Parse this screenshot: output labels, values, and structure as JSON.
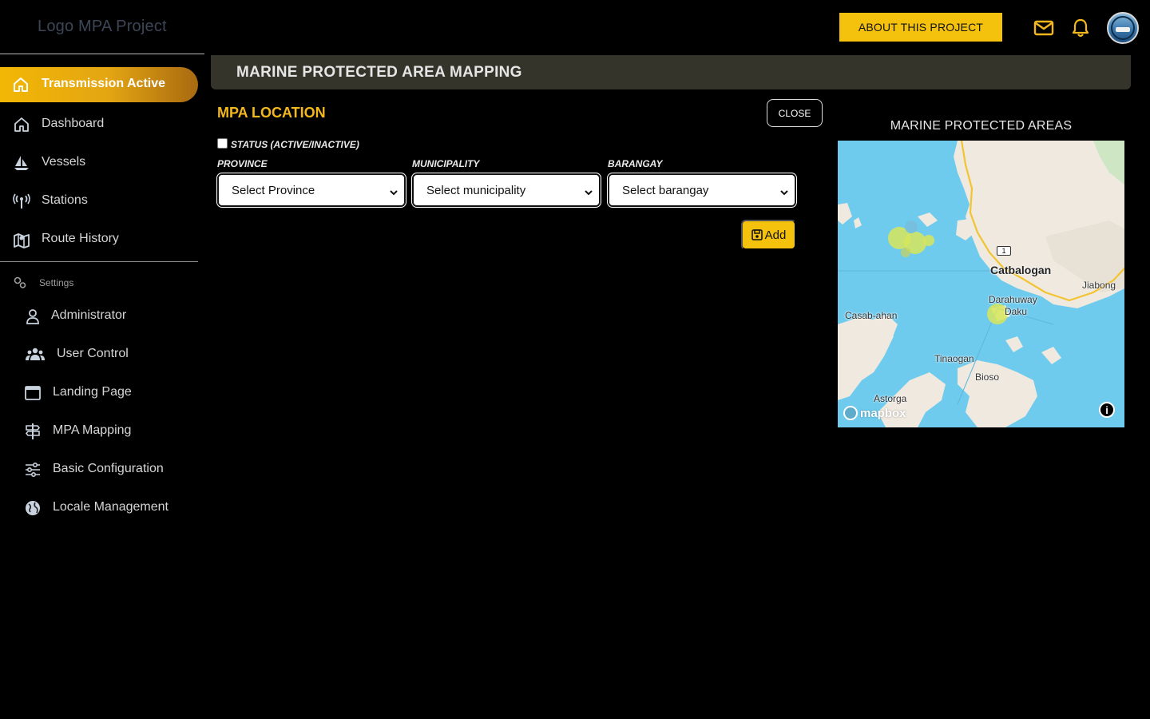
{
  "app": {
    "logo_text": "Logo MPA Project",
    "about_button": "ABOUT THIS PROJECT",
    "mail_icon": "mail-icon",
    "bell_icon": "bell-icon"
  },
  "sidebar": {
    "active_item": {
      "label": "Transmission Active",
      "icon": "home-icon"
    },
    "items": [
      {
        "label": "Dashboard",
        "icon": "home-icon"
      },
      {
        "label": "Vessels",
        "icon": "sailboat-icon"
      },
      {
        "label": "Stations",
        "icon": "antenna-icon"
      },
      {
        "label": "Route History",
        "icon": "map-icon"
      }
    ],
    "settings_label": "Settings",
    "settings_items": [
      {
        "label": "Administrator",
        "icon": "user-icon"
      },
      {
        "label": "User Control",
        "icon": "users-icon"
      },
      {
        "label": "Landing Page",
        "icon": "window-icon"
      },
      {
        "label": "MPA Mapping",
        "icon": "signpost-icon"
      },
      {
        "label": "Basic Configuration",
        "icon": "sliders-icon"
      },
      {
        "label": "Locale Management",
        "icon": "globe-icon"
      }
    ]
  },
  "main": {
    "page_title": "MARINE PROTECTED AREA MAPPING",
    "form_title": "MPA LOCATION",
    "close_button": "CLOSE",
    "status_label": "STATUS (ACTIVE/INACTIVE)",
    "status_checked": false,
    "province": {
      "label": "PROVINCE",
      "selected": "Select Province"
    },
    "municipality": {
      "label": "MUNICIPALITY",
      "selected": "Select municipality"
    },
    "barangay": {
      "label": "BARANGAY",
      "selected": "Select barangay"
    },
    "add_button": "Add"
  },
  "map": {
    "title": "MARINE PROTECTED AREAS",
    "labels": {
      "catbalogan": "Catbalogan",
      "jiabong": "Jiabong",
      "darahuway": "Darahuway",
      "daku": "Daku",
      "casab_ahan": "Casab-ahan",
      "tinaogan": "Tinaogan",
      "bioso": "Bioso",
      "astorga": "Astorga"
    },
    "road_number": "1",
    "attribution": "mapbox",
    "info_glyph": "i",
    "colors": {
      "water": "#6fcbee",
      "land": "#efe9df",
      "mpa": "#d7e65a",
      "road": "#f3c431"
    }
  }
}
